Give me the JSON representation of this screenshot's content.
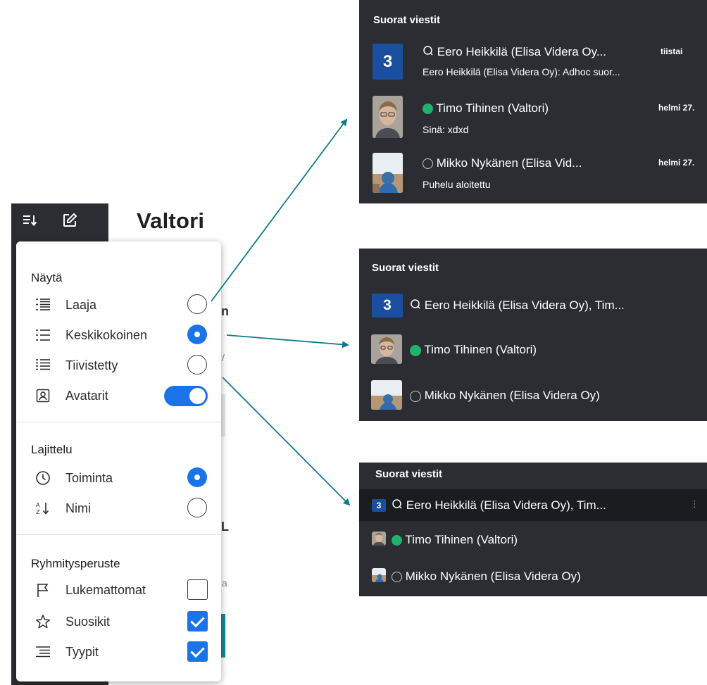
{
  "app": {
    "title": "Valtori",
    "sort_icon": "sort-icon",
    "compose_icon": "compose-icon"
  },
  "menu": {
    "display": {
      "title": "Näytä",
      "options": [
        {
          "label": "Laaja",
          "icon": "density-wide-icon",
          "selected": false
        },
        {
          "label": "Keskikokoinen",
          "icon": "density-medium-icon",
          "selected": true
        },
        {
          "label": "Tiivistetty",
          "icon": "density-compact-icon",
          "selected": false
        }
      ],
      "avatars": {
        "label": "Avatarit",
        "icon": "contact-icon",
        "on": true
      }
    },
    "sort": {
      "title": "Lajittelu",
      "options": [
        {
          "label": "Toiminta",
          "icon": "clock-icon",
          "selected": true
        },
        {
          "label": "Nimi",
          "icon": "sort-az-icon",
          "selected": false
        }
      ]
    },
    "group": {
      "title": "Ryhmitysperuste",
      "options": [
        {
          "label": "Lukemattomat",
          "icon": "flag-icon",
          "checked": false
        },
        {
          "label": "Suosikit",
          "icon": "star-icon",
          "checked": true
        },
        {
          "label": "Tyypit",
          "icon": "types-icon",
          "checked": true
        }
      ]
    }
  },
  "previews": {
    "wide": {
      "title": "Suorat viestit",
      "items": [
        {
          "badge": "3",
          "name": "Eero Heikkilä (Elisa Videra Oy...",
          "date": "tiistai",
          "preview": "Eero Heikkilä (Elisa Videra Oy): Adhoc suor...",
          "status": "chat"
        },
        {
          "name": "Timo Tihinen (Valtori)",
          "date": "helmi 27.",
          "preview": "Sinä: xdxd",
          "status": "online"
        },
        {
          "name": "Mikko Nykänen (Elisa Vid...",
          "date": "helmi 27.",
          "preview": "Puhelu aloitettu",
          "status": "offline"
        }
      ]
    },
    "medium": {
      "title": "Suorat viestit",
      "items": [
        {
          "badge": "3",
          "name": "Eero Heikkilä (Elisa Videra Oy), Tim...",
          "status": "chat"
        },
        {
          "name": "Timo Tihinen (Valtori)",
          "status": "online"
        },
        {
          "name": "Mikko Nykänen (Elisa Videra Oy)",
          "status": "offline"
        }
      ]
    },
    "compact": {
      "title": "Suorat viestit",
      "items": [
        {
          "badge": "3",
          "name": "Eero Heikkilä (Elisa Videra Oy), Tim...",
          "status": "chat"
        },
        {
          "name": "Timo Tihinen (Valtori)",
          "status": "online"
        },
        {
          "name": "Mikko Nykänen (Elisa Videra Oy)",
          "status": "offline"
        }
      ]
    }
  },
  "colors": {
    "accent": "#1a73e8",
    "panel": "#2b2d33",
    "badge": "#1a4fa0",
    "online": "#21b26b",
    "arrow": "#0e7c8c"
  }
}
